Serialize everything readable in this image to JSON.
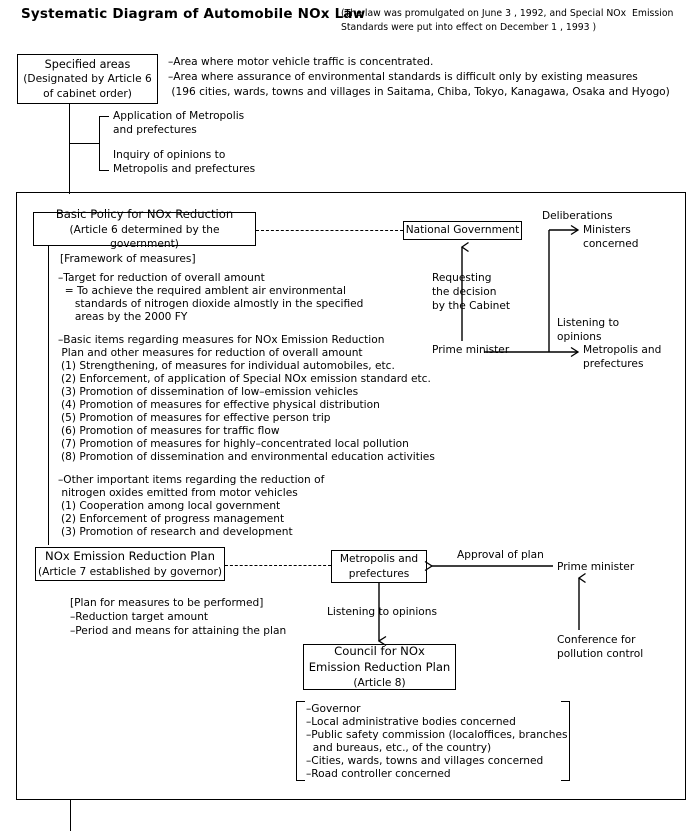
{
  "header": {
    "title": "Systematic Diagram of Automobile NOx Law",
    "note_line1": "(The law was promulgated on June 3 , 1992, and Special NOx  Emission",
    "note_line2": "Standards were put into effect on December 1 , 1993 )"
  },
  "specified_areas": {
    "line1": "Specified areas",
    "line2": "(Designated by Article 6",
    "line3": "of cabinet order)"
  },
  "area_notes": {
    "line1": "–Area where motor vehicle traffic is concentrated.",
    "line2": "–Area where assurance of environmental standards is difficult only by existing measures",
    "line3": " (196 cities, wards, towns and villages in Saitama, Chiba, Tokyo, Kanagawa, Osaka and Hyogo)"
  },
  "branch_labels": {
    "application_line1": "Application of Metropolis",
    "application_line2": "and prefectures",
    "inquiry_line1": "Inquiry of opinions to",
    "inquiry_line2": "Metropolis and prefectures"
  },
  "basic_policy": {
    "line1": "Basic Policy for NOx Reduction",
    "line2": "(Article 6 determined by the government)"
  },
  "framework": {
    "heading": "[Framework of measures]",
    "target_line1": "–Target for reduction of overall amount",
    "target_line2": "  = To achieve the required amblent air environmental",
    "target_line3": "     standards of nitrogen dioxide almostly in the specified",
    "target_line4": "     areas by the 2000 FY",
    "basic_items_line1": "–Basic items regarding measures for NOx Emission Reduction",
    "basic_items_line2": " Plan and other measures for reduction of overall amount",
    "basic_items": [
      "(1) Strengthening, of measures for individual automobiles, etc.",
      "(2) Enforcement, of application of Special NOx emission standard etc.",
      "(3) Promotion of dissemination of low–emission vehicles",
      "(4) Promotion of measures for effective physical distribution",
      "(5) Promotion of measures for effective person trip",
      "(6) Promotion of measures for traffic flow",
      "(7) Promotion of measures for highly–concentrated local pollution",
      "(8) Promotion of dissemination and environmental education activities"
    ],
    "other_line1": "–Other important items regarding the reduction of",
    "other_line2": " nitrogen oxides emitted from motor vehicles",
    "other_items": [
      "(1) Cooperation among local government",
      "(2) Enforcement of progress management",
      "(3) Promotion of research and development"
    ]
  },
  "national_government": {
    "label": "National Government"
  },
  "cabinet_request": {
    "line1": "Requesting",
    "line2": "the decision",
    "line3": "by the Cabinet"
  },
  "prime_minister_top": {
    "label": "Prime minister"
  },
  "deliberations": {
    "label": "Deliberations",
    "target_line1": "Ministers",
    "target_line2": "concerned"
  },
  "listening_top": {
    "label_line1": "Listening to",
    "label_line2": "opinions",
    "target_line1": "Metropolis and",
    "target_line2": "prefectures"
  },
  "nox_plan": {
    "line1": "NOx Emission Reduction Plan",
    "line2": "(Article 7 established by governor)"
  },
  "plan_details": {
    "heading": "[Plan for measures to be performed]",
    "item1": "–Reduction target amount",
    "item2": "–Period and means for attaining the plan"
  },
  "metropolis_box": {
    "line1": "Metropolis and",
    "line2": "prefectures"
  },
  "approval": {
    "label": "Approval of plan"
  },
  "prime_minister_bottom": {
    "label": "Prime minister"
  },
  "conference": {
    "line1": "Conference for",
    "line2": "pollution control"
  },
  "listening_bottom": {
    "label": "Listening to opinions"
  },
  "council": {
    "line1": "Council for NOx",
    "line2": "Emission Reduction Plan",
    "line3": "(Article 8)"
  },
  "council_members": [
    "–Governor",
    "–Local administrative bodies concerned",
    "–Public safety commission (localoffices, branches",
    "  and bureaus, etc., of the country)",
    "–Cities, wards, towns and villages concerned",
    "–Road controller concerned"
  ],
  "colors": {
    "stroke": "#000000",
    "background": "#ffffff"
  }
}
